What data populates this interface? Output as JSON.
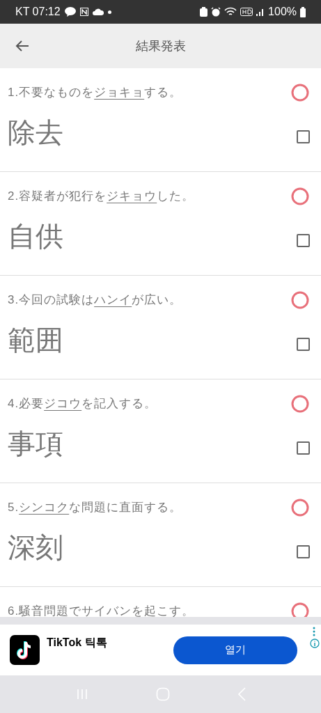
{
  "status_bar": {
    "carrier_time": "KT 07:12",
    "battery": "100%"
  },
  "header": {
    "title": "結果発表"
  },
  "questions": [
    {
      "number": "1.",
      "before": "不要なものを",
      "target": "ジョキョ",
      "after": "する。",
      "answer": "除去",
      "correct": true,
      "checked": false
    },
    {
      "number": "2.",
      "before": "容疑者が犯行を",
      "target": "ジキョウ",
      "after": "した。",
      "answer": "自供",
      "correct": true,
      "checked": false
    },
    {
      "number": "3.",
      "before": "今回の試験は",
      "target": "ハンイ",
      "after": "が広い。",
      "answer": "範囲",
      "correct": true,
      "checked": false
    },
    {
      "number": "4.",
      "before": "必要",
      "target": "ジコウ",
      "after": "を記入する。",
      "answer": "事項",
      "correct": true,
      "checked": false
    },
    {
      "number": "5.",
      "target": "シンコク",
      "after": "な問題に直面する。",
      "answer": "深刻",
      "correct": true,
      "checked": false
    },
    {
      "number": "6.",
      "before": "騒音問題で",
      "target": "サイバン",
      "after": "を起こす。",
      "correct": true
    }
  ],
  "ad": {
    "app_name": "TikTok 틱톡",
    "button": "열기"
  }
}
